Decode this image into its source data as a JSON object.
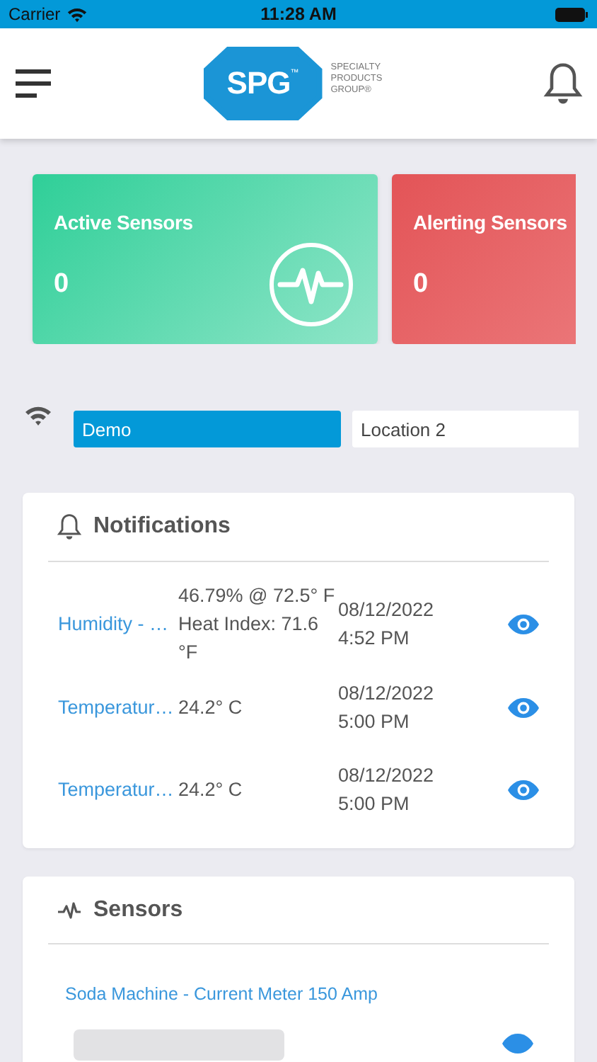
{
  "status_bar": {
    "carrier": "Carrier",
    "time": "11:28 AM"
  },
  "header": {
    "logo": {
      "mark": "SPG",
      "trademark": "™",
      "lines": [
        "SPECIALTY",
        "PRODUCTS",
        "GROUP®"
      ]
    }
  },
  "summary_cards": [
    {
      "kind": "active",
      "title": "Active Sensors",
      "count": "0"
    },
    {
      "kind": "alerting",
      "title": "Alerting Sensors",
      "count": "0"
    }
  ],
  "locations": [
    {
      "label": "Demo",
      "selected": true
    },
    {
      "label": "Location 2",
      "selected": false
    }
  ],
  "notifications": {
    "title": "Notifications",
    "rows": [
      {
        "name": "Humidity - …",
        "value": "46.79% @ 72.5° F Heat Index: 71.6 °F",
        "date": "08/12/2022",
        "time": "4:52 PM"
      },
      {
        "name": "Temperatur…",
        "value": "24.2° C",
        "date": "08/12/2022",
        "time": "5:00 PM"
      },
      {
        "name": "Temperatur…",
        "value": "24.2° C",
        "date": "08/12/2022",
        "time": "5:00 PM"
      }
    ]
  },
  "sensors": {
    "title": "Sensors",
    "items": [
      {
        "name": "Soda Machine - Current Meter 150 Amp"
      }
    ]
  }
}
